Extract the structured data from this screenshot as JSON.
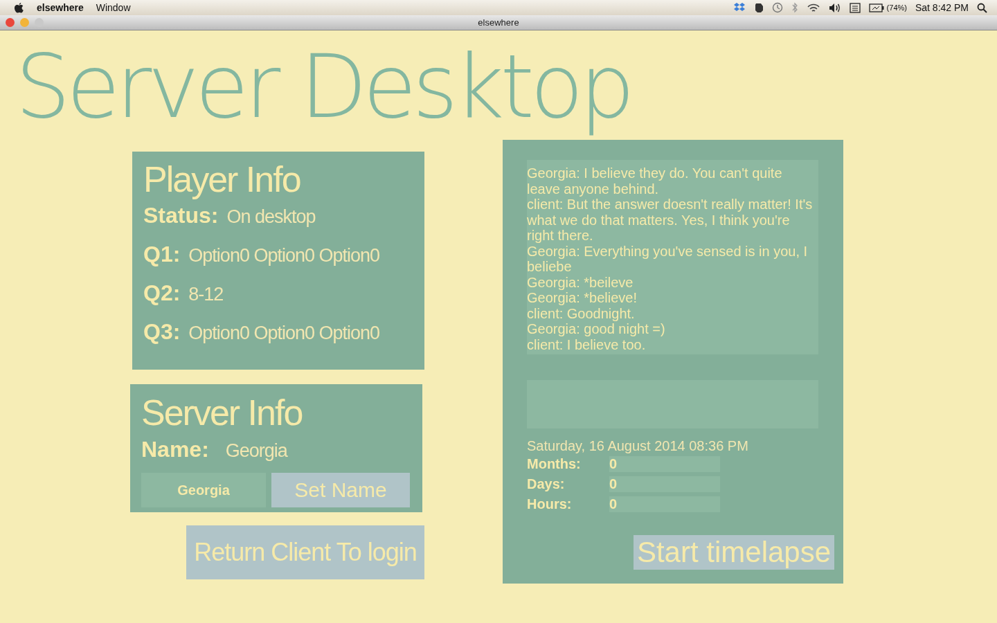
{
  "menu_bar": {
    "app_name": "elsewhere",
    "menus": [
      "Window"
    ],
    "battery": "(74%)",
    "clock": "Sat 8:42 PM"
  },
  "window": {
    "title": "elsewhere"
  },
  "app_title": "Server Desktop",
  "player_info": {
    "title": "Player Info",
    "rows": [
      {
        "label": "Status:",
        "value": "On desktop"
      },
      {
        "label": "Q1:",
        "value": "Option0 Option0 Option0"
      },
      {
        "label": "Q2:",
        "value": "8-12"
      },
      {
        "label": "Q3:",
        "value": "Option0 Option0 Option0"
      }
    ]
  },
  "server_info": {
    "title": "Server Info",
    "name_label": "Name:",
    "name_value": "Georgia",
    "name_field": "Georgia",
    "set_button": "Set Name"
  },
  "return_button": "Return Client To login",
  "chat": {
    "messages": [
      "Georgia: I believe they do. You can't quite leave anyone behind.",
      "client: But the answer doesn't really matter! It's what we do that matters. Yes, I think you're right there.",
      "Georgia: Everything you've sensed is in you, I beliebe",
      "Georgia: *beileve",
      "Georgia: *believe!",
      "client: Goodnight.",
      "Georgia: good night =)",
      "client: I believe too."
    ]
  },
  "timestamp": "Saturday, 16 August 2014  08:36 PM",
  "timelapse": [
    {
      "label": "Months:",
      "value": "0"
    },
    {
      "label": "Days:",
      "value": "0"
    },
    {
      "label": "Hours:",
      "value": "0"
    }
  ],
  "start_button": "Start timelapse"
}
